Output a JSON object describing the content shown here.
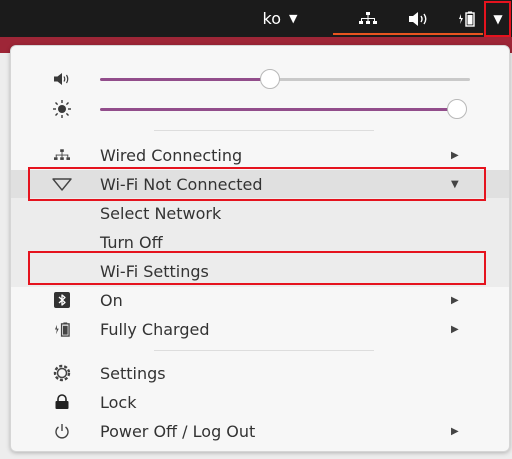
{
  "topbar": {
    "language_label": "ko",
    "language_caret": "▼",
    "network_icon": "network-wired-icon",
    "volume_icon": "volume-icon",
    "battery_icon": "battery-charging-icon",
    "system_menu_caret": "▼"
  },
  "sliders": {
    "volume": {
      "icon": "speaker-icon",
      "level": 0.37
    },
    "brightness": {
      "icon": "brightness-sun-icon",
      "level": 1.0
    }
  },
  "menu": {
    "wired": {
      "icon": "network-wired-icon",
      "label": "Wired Connecting",
      "arrow": "▶"
    },
    "wifi": {
      "icon": "wifi-icon",
      "label": "Wi-Fi Not Connected",
      "arrow": "▼"
    },
    "wifi_submenu": [
      {
        "label": "Select Network"
      },
      {
        "label": "Turn Off"
      },
      {
        "label": "Wi-Fi Settings"
      }
    ],
    "bluetooth": {
      "icon": "bluetooth-icon",
      "label": "On",
      "arrow": "▶"
    },
    "power": {
      "icon": "battery-charging-icon",
      "label": "Fully Charged",
      "arrow": "▶"
    },
    "settings": {
      "icon": "settings-gear-icon",
      "label": "Settings"
    },
    "lock": {
      "icon": "lock-icon",
      "label": "Lock"
    },
    "power_off": {
      "icon": "power-icon",
      "label": "Power Off / Log Out",
      "arrow": "▶"
    }
  },
  "colors": {
    "topbar_bg": "#1b1b1b",
    "accent_orange": "#e95420",
    "slider_purple": "#924d8b",
    "highlight_red": "#e5131e"
  }
}
